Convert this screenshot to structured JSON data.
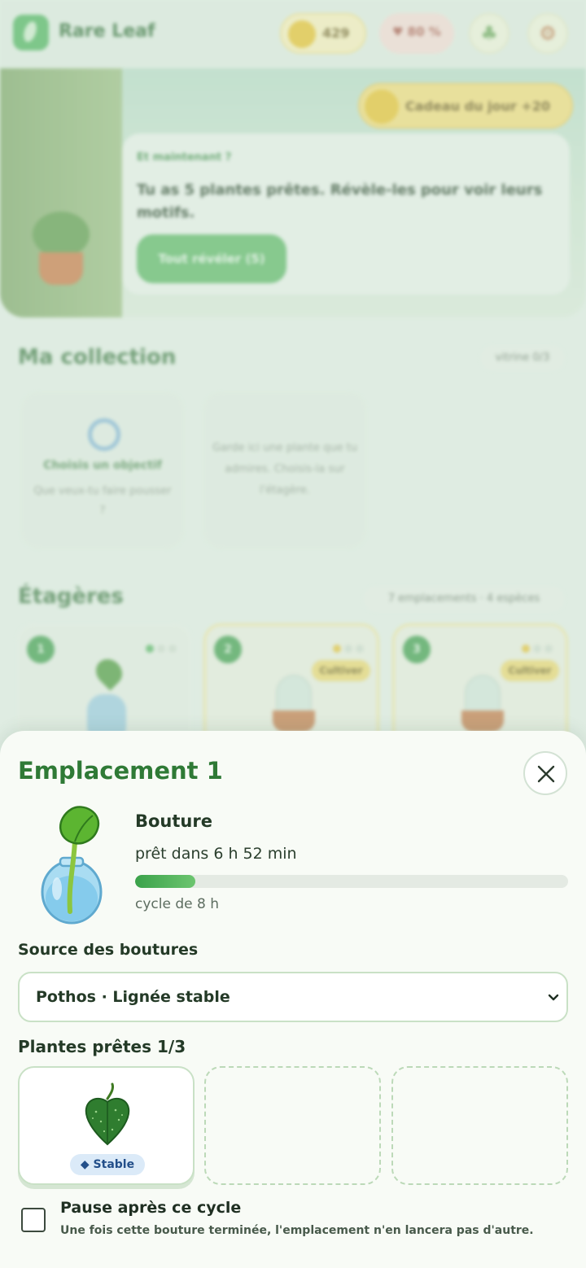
{
  "app": {
    "title": "Rare Leaf",
    "coins": "429",
    "health": "♥ 80 %"
  },
  "hero": {
    "gift_label": "Cadeau du jour +20",
    "kicker": "Et maintenant ?",
    "text": "Tu as 5 plantes prêtes. Révèle-les pour voir leurs motifs.",
    "button": "Tout révéler (5)"
  },
  "collection": {
    "title": "Ma collection",
    "badge": "vitrine 0/3",
    "goal_title": "Choisis un objectif",
    "goal_sub": "Que veux-tu faire pousser ?",
    "hint": "Garde ici une plante que tu admires. Choisis-la sur l'étagère."
  },
  "shelves": {
    "title": "Étagères",
    "meta": "7 emplacements · 4 espèces",
    "cards": [
      {
        "number": "1",
        "tag": ""
      },
      {
        "number": "2",
        "tag": "Cultiver"
      },
      {
        "number": "3",
        "tag": "Cultiver"
      }
    ]
  },
  "sheet": {
    "title": "Emplacement 1",
    "plant_name": "Bouture",
    "eta": "prêt dans 6 h 52 min",
    "progress": 0.14,
    "cycle": "cycle de 8 h",
    "source_label": "Source des boutures",
    "source_value": "Pothos · Lignée stable",
    "ready_label": "Plantes prêtes 1/3",
    "ready_items": [
      {
        "badge": "◆ Stable"
      }
    ],
    "pause_title": "Pause après ce cycle",
    "pause_sub": "Une fois cette bouture terminée, l'emplacement n'en lancera pas d'autre.",
    "pause_checked": false
  },
  "colors": {
    "accent": "#2f7a36",
    "progress": "#3aa24a",
    "badge_bg": "#dbeaf8"
  },
  "icons": [
    "close-icon",
    "chevron-down-icon",
    "leaf-icon",
    "coin-icon",
    "gear-icon"
  ]
}
